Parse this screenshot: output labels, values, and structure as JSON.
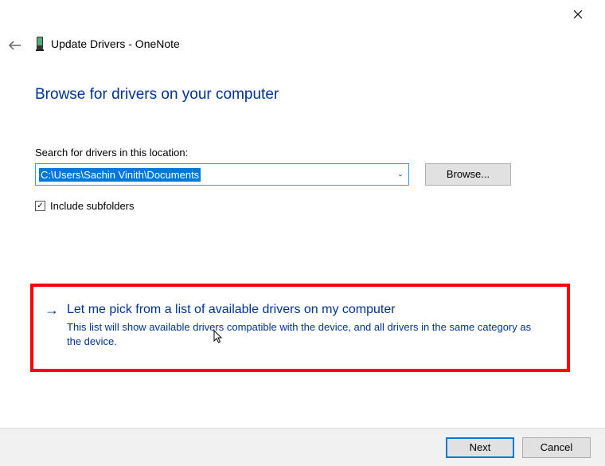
{
  "window": {
    "title": "Update Drivers - OneNote"
  },
  "heading": "Browse for drivers on your computer",
  "search": {
    "label": "Search for drivers in this location:",
    "path": "C:\\Users\\Sachin Vinith\\Documents",
    "browse_label": "Browse..."
  },
  "checkbox": {
    "label": "Include subfolders",
    "checked_glyph": "✓"
  },
  "option": {
    "title": "Let me pick from a list of available drivers on my computer",
    "description": "This list will show available drivers compatible with the device, and all drivers in the same category as the device."
  },
  "footer": {
    "next_label": "Next",
    "cancel_label": "Cancel"
  }
}
